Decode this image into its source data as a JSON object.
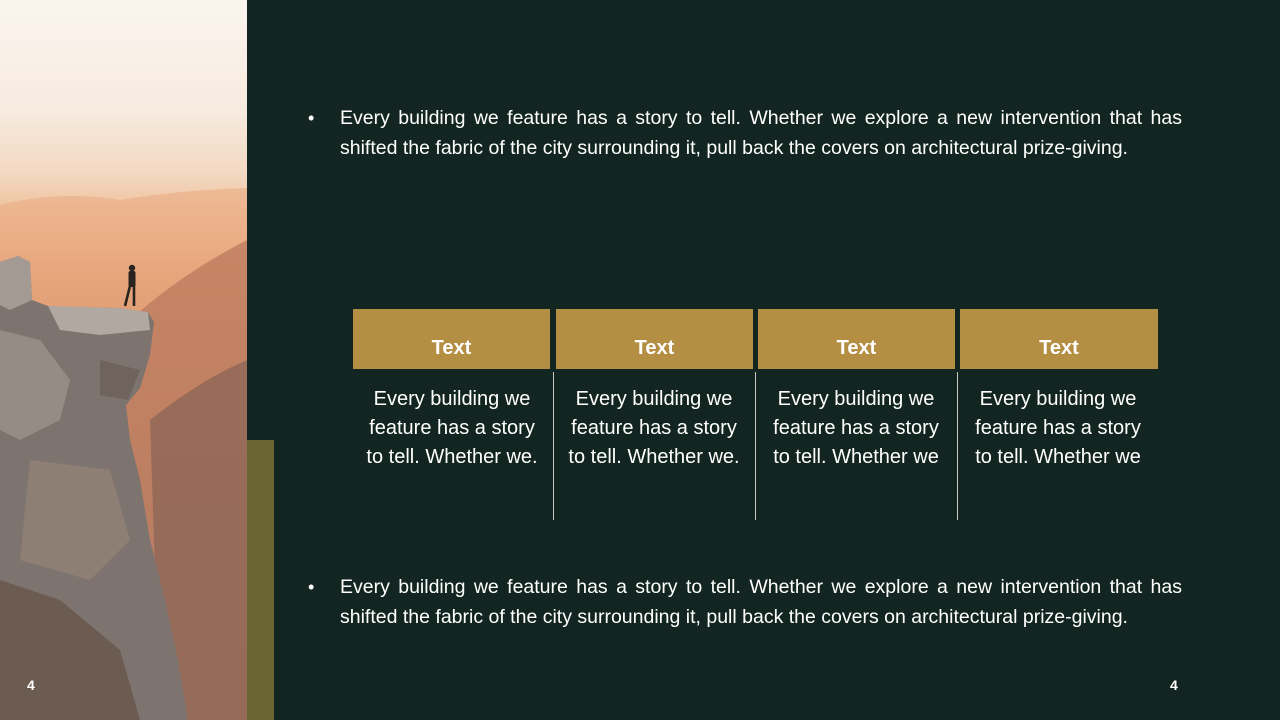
{
  "bullets": [
    "Every building we feature has a story to tell. Whether we explore a new intervention that has shifted the fabric of the city surrounding it, pull back the covers on architectural prize-giving.",
    "Every building we feature has a story to tell. Whether we explore a new intervention that has shifted the fabric of the city surrounding it, pull back the covers on architectural prize-giving."
  ],
  "table": {
    "headers": [
      "Text",
      "Text",
      "Text",
      "Text"
    ],
    "cells": [
      "Every building we feature has a story to tell. Whether we.",
      "Every building we feature has a story to tell. Whether we.",
      "Every building we feature has a story to tell. Whether we",
      "Every building we feature has a story to tell. Whether we"
    ]
  },
  "page_number": "4",
  "corner_label": "4",
  "colors": {
    "background": "#132520",
    "header_fill": "#b38e43",
    "accent_bar": "#6b6433",
    "text": "#ffffff"
  },
  "photo": {
    "icon": "cliff-hiker-photo"
  }
}
